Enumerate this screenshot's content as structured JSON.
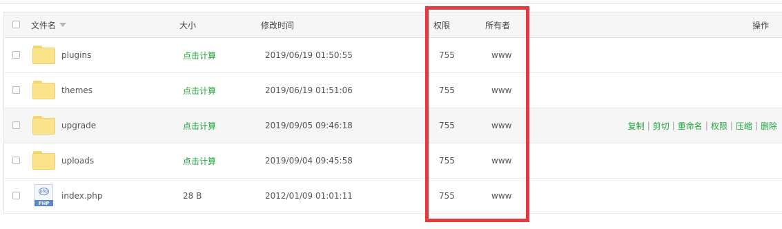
{
  "header": {
    "name": "文件名",
    "size": "大小",
    "mtime": "修改时间",
    "perm": "权限",
    "owner": "所有者",
    "actions": "操作"
  },
  "rows": [
    {
      "type": "folder",
      "name": "plugins",
      "size": "点击计算",
      "mtime": "2019/06/19 01:50:55",
      "perm": "755",
      "owner": "www"
    },
    {
      "type": "folder",
      "name": "themes",
      "size": "点击计算",
      "mtime": "2019/06/19 01:51:06",
      "perm": "755",
      "owner": "www"
    },
    {
      "type": "folder",
      "name": "upgrade",
      "size": "点击计算",
      "mtime": "2019/09/05 09:46:18",
      "perm": "755",
      "owner": "www"
    },
    {
      "type": "folder",
      "name": "uploads",
      "size": "点击计算",
      "mtime": "2019/09/04 09:45:58",
      "perm": "755",
      "owner": "www"
    },
    {
      "type": "php",
      "name": "index.php",
      "size": "28 B",
      "mtime": "2012/01/09 01:01:11",
      "perm": "755",
      "owner": "www"
    }
  ],
  "row_actions": [
    "复制",
    "剪切",
    "重命名",
    "权限",
    "压缩",
    "删除"
  ],
  "php_icon": {
    "ring": "php",
    "band": "PHP"
  },
  "colors": {
    "accent": "#20a53a",
    "highlight": "#e8383b"
  }
}
